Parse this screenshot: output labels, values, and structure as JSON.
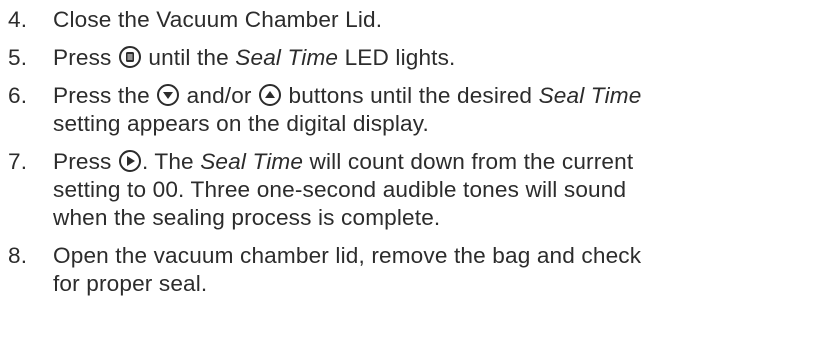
{
  "steps": [
    {
      "number": "4.",
      "lines": [
        {
          "a": "Close the Vacuum Chamber Lid."
        }
      ]
    },
    {
      "number": "5.",
      "lines": [
        {
          "a": "Press ",
          "icon": "menu-select-button-icon",
          "b": " until the ",
          "em": "Seal Time",
          "c": " LED lights."
        }
      ]
    },
    {
      "number": "6.",
      "lines": [
        {
          "a": "Press the ",
          "icon1": "down-arrow-button-icon",
          "b": " and/or ",
          "icon2": "up-arrow-button-icon",
          "c": " buttons until the desired ",
          "em": "Seal Time"
        },
        {
          "a": "setting appears on the digital display."
        }
      ]
    },
    {
      "number": "7.",
      "lines": [
        {
          "a": "Press ",
          "icon": "start-play-button-icon",
          "b": ". The ",
          "em": "Seal Time",
          "c": " will count down from the current"
        },
        {
          "a": "setting to 00. Three one-second audible tones will sound"
        },
        {
          "a": "when the sealing process is complete."
        }
      ]
    },
    {
      "number": "8.",
      "lines": [
        {
          "a": "Open the vacuum chamber lid, remove the bag and check"
        },
        {
          "a": "for proper seal."
        }
      ]
    }
  ]
}
